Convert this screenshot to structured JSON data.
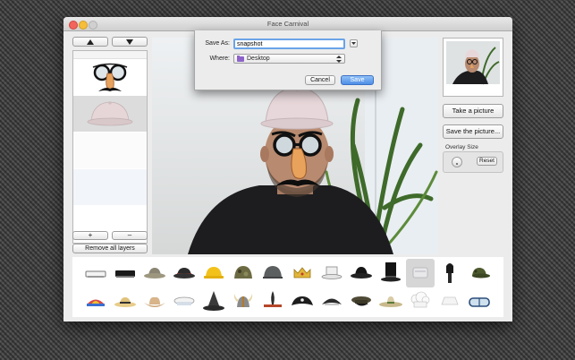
{
  "window": {
    "title": "Face Carnival"
  },
  "layers": {
    "remove_all_label": "Remove all layers",
    "add_label": "+",
    "remove_label": "–"
  },
  "save_sheet": {
    "save_as_label": "Save As:",
    "filename": "snapshot",
    "where_label": "Where:",
    "where_value": "Desktop",
    "cancel_label": "Cancel",
    "save_label": "Save"
  },
  "actions": {
    "take_picture_label": "Take a picture",
    "save_picture_label": "Save the picture...",
    "overlay_size_label": "Overlay Size",
    "reset_label": "Reset"
  },
  "colors": {
    "accent": "#4f8fe6",
    "folder": "#8d63c9"
  },
  "hats_row1": [
    "white-cap",
    "black-cap",
    "safari-hat",
    "red-bowler",
    "hard-hat",
    "camo-helmet",
    "steel-helmet",
    "crown",
    "white-top-hat",
    "black-bowler",
    "tall-top-hat",
    "glass-hat",
    "busby",
    "army-cap"
  ],
  "hats_row2": [
    "jester-hat",
    "straw-hat",
    "cowboy-hat",
    "sailor-cap",
    "wizard-hat",
    "viking-helmet",
    "feather-headband",
    "pirate-hat",
    "bicorne-hat",
    "military-cap",
    "sombrero",
    "chef-hat",
    "nurse-cap",
    "diving-goggles"
  ]
}
